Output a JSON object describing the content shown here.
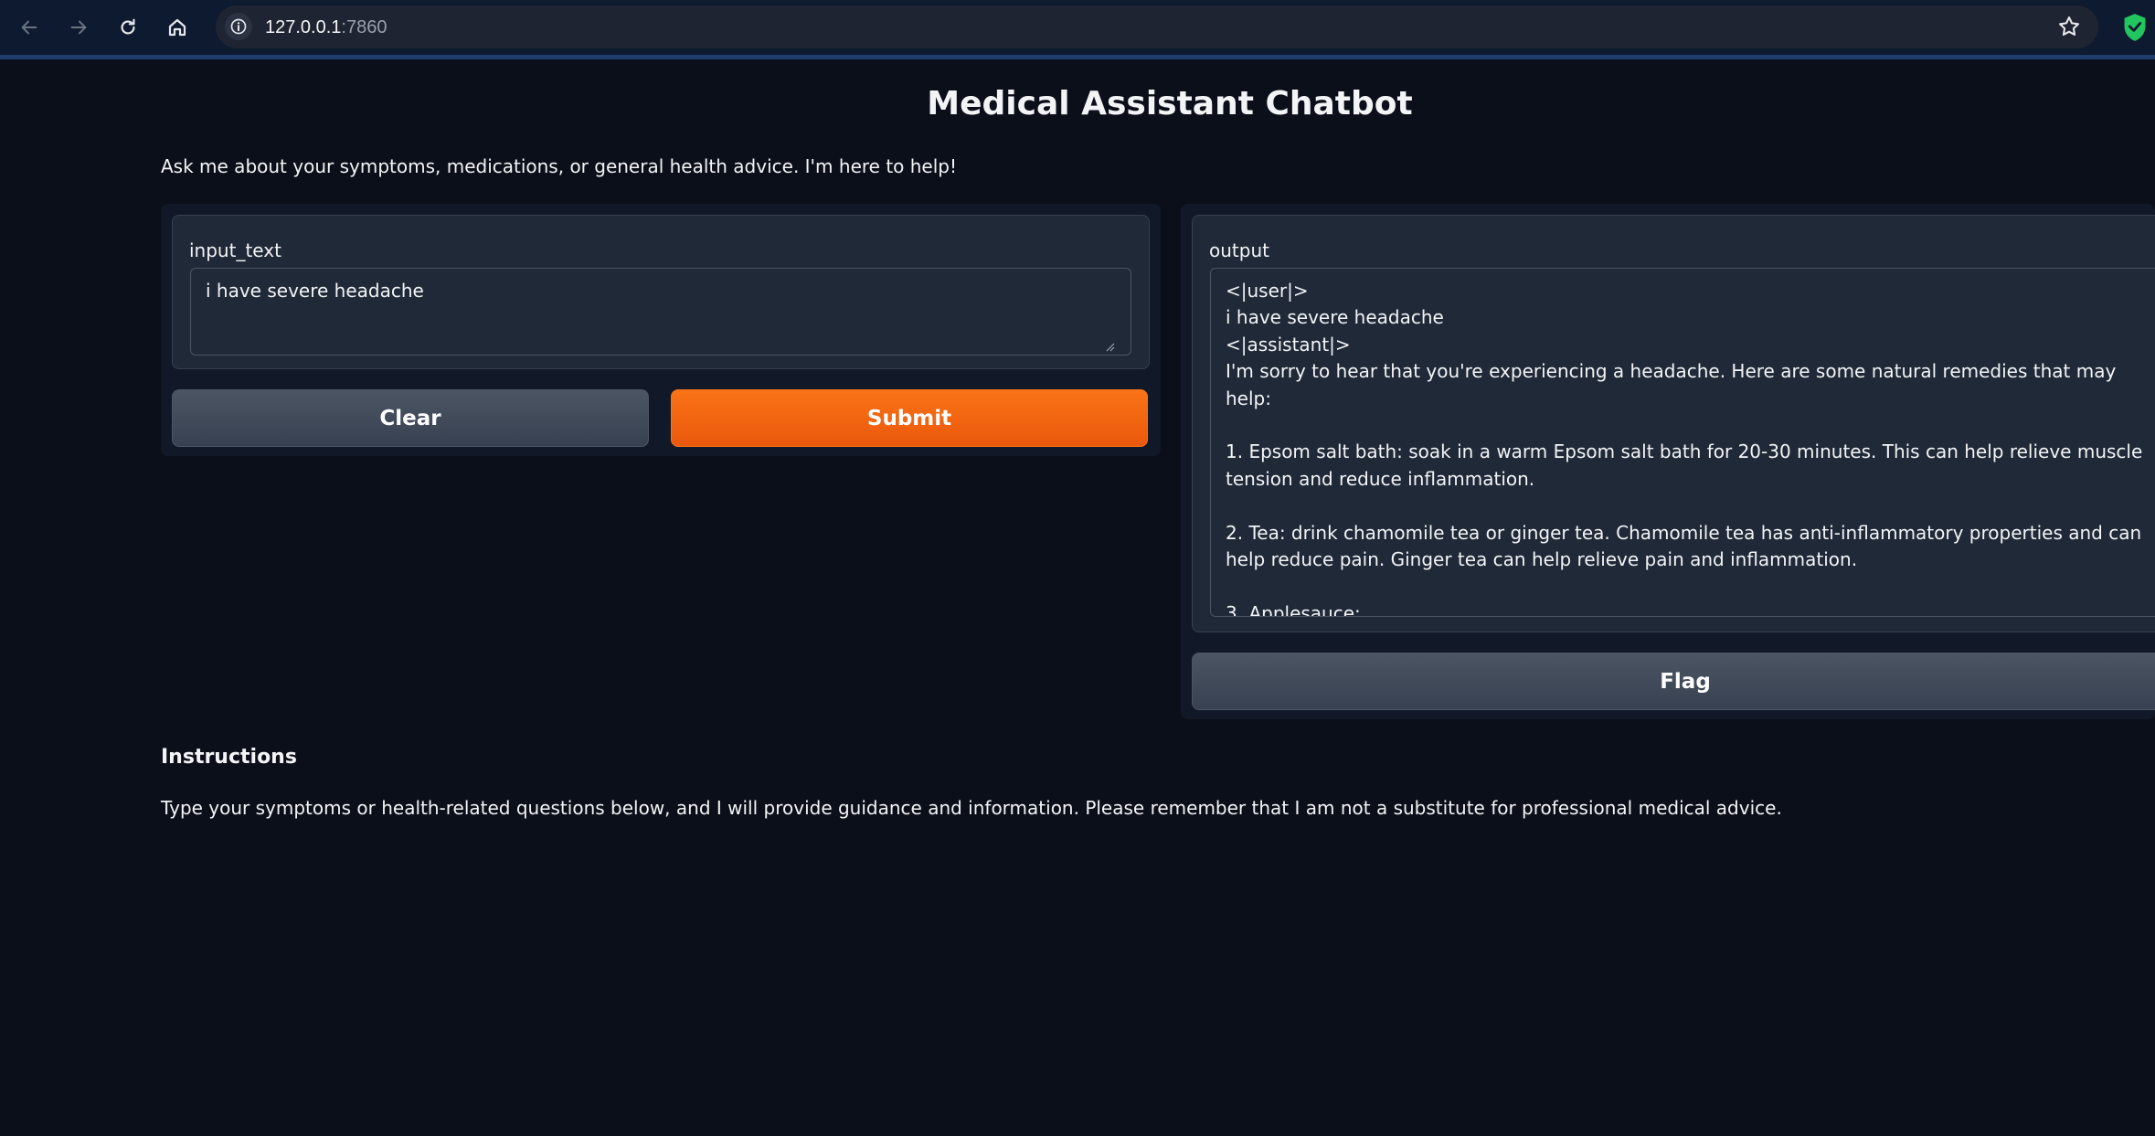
{
  "browser": {
    "url_host": "127.0.0.1",
    "url_port": ":7860"
  },
  "app": {
    "title": "Medical Assistant Chatbot",
    "description": "Ask me about your symptoms, medications, or general health advice. I'm here to help!"
  },
  "input": {
    "label": "input_text",
    "value": "i have severe headache"
  },
  "output": {
    "label": "output",
    "value": "<|user|>\ni have severe headache\n<|assistant|>\nI'm sorry to hear that you're experiencing a headache. Here are some natural remedies that may help:\n\n1. Epsom salt bath: soak in a warm Epsom salt bath for 20-30 minutes. This can help relieve muscle tension and reduce inflammation.\n\n2. Tea: drink chamomile tea or ginger tea. Chamomile tea has anti-inflammatory properties and can help reduce pain. Ginger tea can help relieve pain and inflammation.\n\n3. Applesauce:"
  },
  "buttons": {
    "clear": "Clear",
    "submit": "Submit",
    "flag": "Flag"
  },
  "instructions": {
    "heading": "Instructions",
    "text": "Type your symptoms or health-related questions below, and I will provide guidance and information. Please remember that I am not a substitute for professional medical advice."
  },
  "colors": {
    "background": "#0b0f19",
    "primary_button": "#f97316",
    "secondary_button": "#4b5563"
  },
  "icons": [
    "back-arrow-icon",
    "forward-arrow-icon",
    "reload-icon",
    "home-icon",
    "site-info-icon",
    "bookmark-star-icon",
    "shield-extension-icon"
  ]
}
